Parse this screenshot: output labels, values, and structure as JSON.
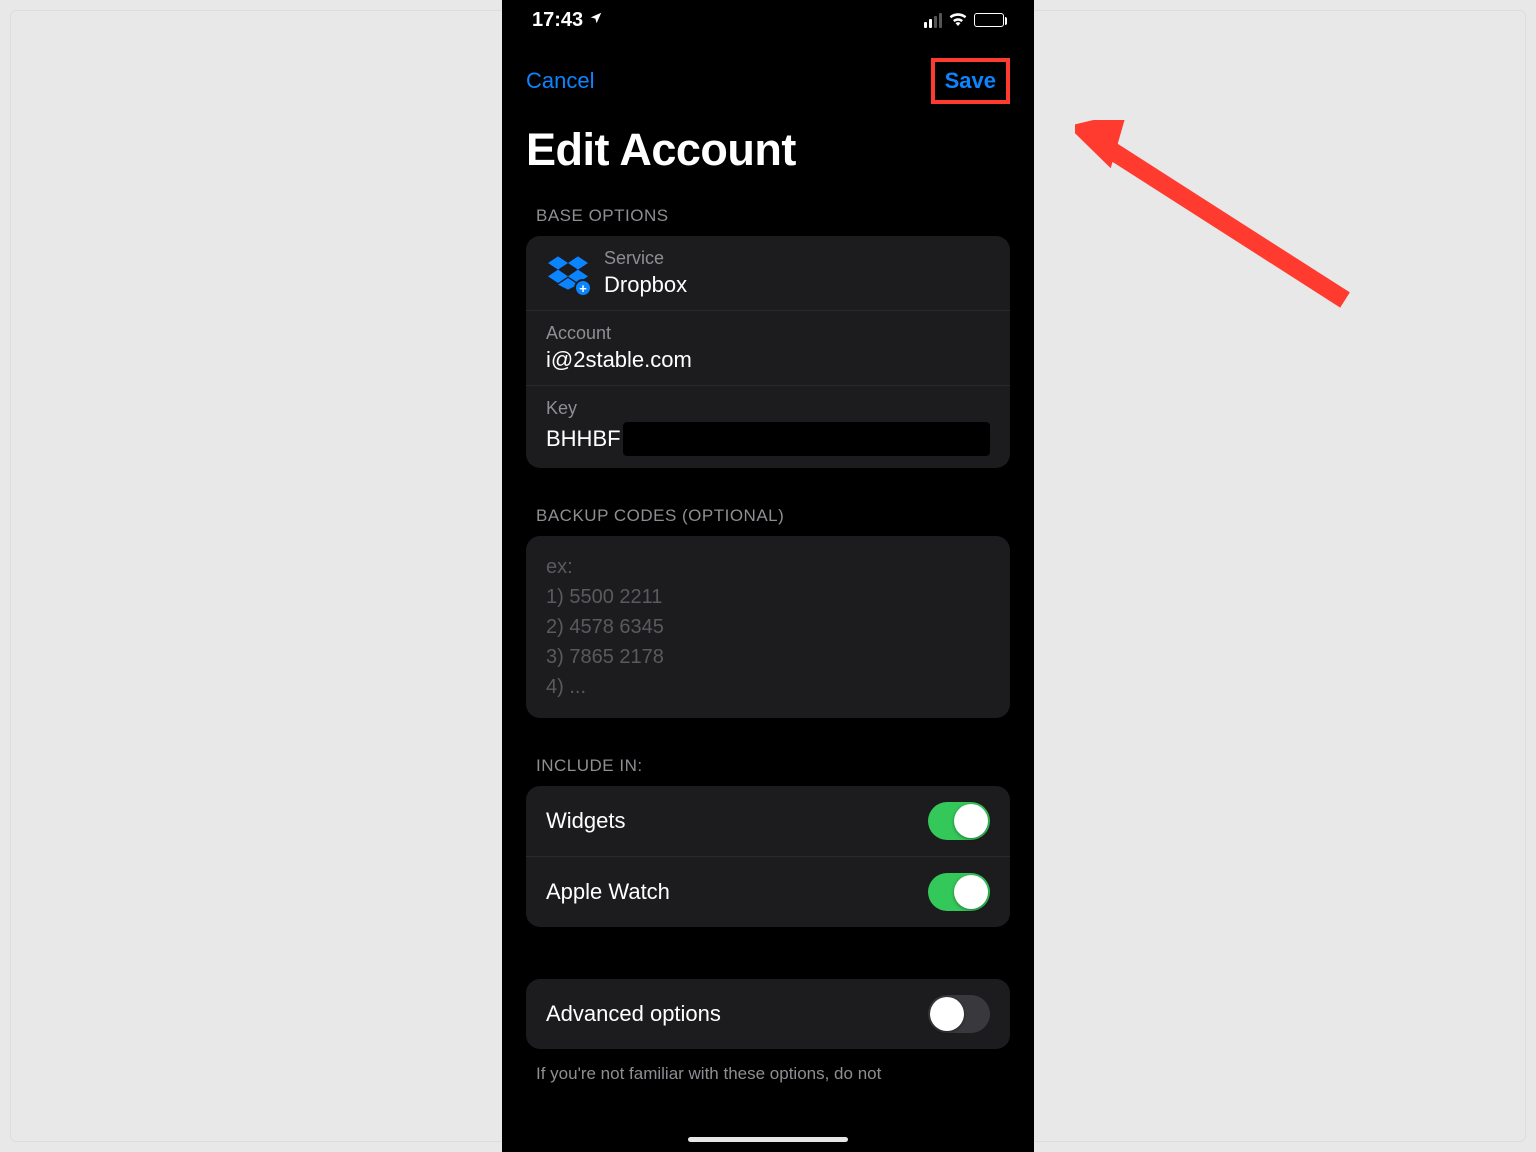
{
  "statusbar": {
    "time": "17:43"
  },
  "nav": {
    "cancel": "Cancel",
    "save": "Save"
  },
  "title": "Edit Account",
  "sections": {
    "base": {
      "header": "BASE OPTIONS",
      "service_label": "Service",
      "service_value": "Dropbox",
      "account_label": "Account",
      "account_value": "i@2stable.com",
      "key_label": "Key",
      "key_prefix": "BHHBF"
    },
    "backup": {
      "header": "BACKUP CODES (OPTIONAL)",
      "placeholder": "ex:\n1) 5500 2211\n2) 4578 6345\n3) 7865 2178\n4) ..."
    },
    "include": {
      "header": "INCLUDE IN:",
      "widgets": "Widgets",
      "applewatch": "Apple Watch",
      "widgets_on": true,
      "applewatch_on": true
    },
    "advanced": {
      "label": "Advanced options",
      "on": false,
      "footer": "If you're not familiar with these options, do not"
    }
  }
}
